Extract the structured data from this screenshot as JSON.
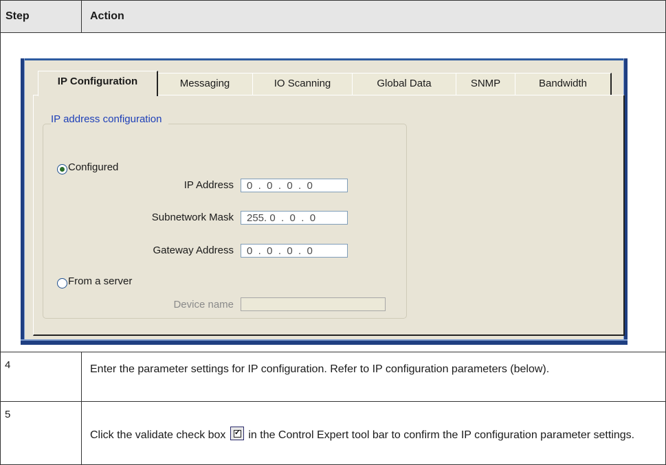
{
  "table": {
    "header": {
      "step": "Step",
      "action": "Action"
    },
    "rows": [
      {
        "step": "4",
        "action": "Enter the parameter settings for IP configuration. Refer to IP configuration parameters (below)."
      },
      {
        "step": "5",
        "action_before": "Click the validate check box",
        "action_after": "in the Control Expert tool bar to confirm the IP configuration parameter settings.",
        "icon": "validate-checkbox-icon"
      }
    ]
  },
  "screenshot": {
    "tabs": [
      {
        "label": "IP Configuration",
        "active": true
      },
      {
        "label": "Messaging",
        "active": false
      },
      {
        "label": "IO Scanning",
        "active": false
      },
      {
        "label": "Global Data",
        "active": false
      },
      {
        "label": "SNMP",
        "active": false
      },
      {
        "label": "Bandwidth",
        "active": false
      }
    ],
    "group_title": "IP address configuration",
    "configured": {
      "label": "Configured",
      "selected": true,
      "ip_address_label": "IP Address",
      "ip_address_value": "0  .  0  .  0  .  0",
      "subnet_label": "Subnetwork Mask",
      "subnet_value": "255. 0  .  0  .  0",
      "gateway_label": "Gateway Address",
      "gateway_value": "0  .  0  .  0  .  0"
    },
    "from_server": {
      "label": "From a server",
      "selected": false,
      "device_name_label": "Device name",
      "device_name_value": ""
    }
  }
}
